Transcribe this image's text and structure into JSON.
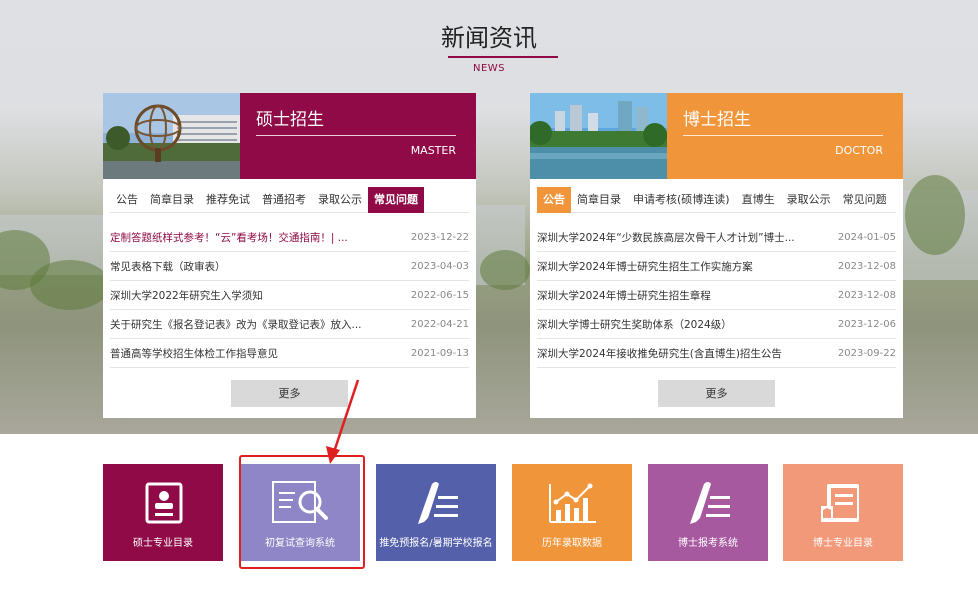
{
  "section": {
    "title": "新闻资讯",
    "subtitle": "NEWS"
  },
  "master": {
    "title": "硕士招生",
    "subtitle": "MASTER",
    "tabs": [
      {
        "label": "公告",
        "active": false
      },
      {
        "label": "简章目录",
        "active": false
      },
      {
        "label": "推荐免试",
        "active": false
      },
      {
        "label": "普通招考",
        "active": false
      },
      {
        "label": "录取公示",
        "active": false
      },
      {
        "label": "常见问题",
        "active": true
      }
    ],
    "news": [
      {
        "title": "定制答题纸样式参考！“云”看考场！交通指南！| ...",
        "date": "2023-12-22",
        "highlight": true
      },
      {
        "title": "常见表格下载（政审表）",
        "date": "2023-04-03",
        "highlight": false
      },
      {
        "title": "深圳大学2022年研究生入学须知",
        "date": "2022-06-15",
        "highlight": false
      },
      {
        "title": "关于研究生《报名登记表》改为《录取登记表》放入...",
        "date": "2022-04-21",
        "highlight": false
      },
      {
        "title": "普通高等学校招生体检工作指导意见",
        "date": "2021-09-13",
        "highlight": false
      }
    ],
    "more": "更多"
  },
  "doctor": {
    "title": "博士招生",
    "subtitle": "DOCTOR",
    "tabs": [
      {
        "label": "公告",
        "active": true
      },
      {
        "label": "简章目录",
        "active": false
      },
      {
        "label": "申请考核(硕博连读)",
        "active": false
      },
      {
        "label": "直博生",
        "active": false
      },
      {
        "label": "录取公示",
        "active": false
      },
      {
        "label": "常见问题",
        "active": false
      }
    ],
    "news": [
      {
        "title": "深圳大学2024年“少数民族高层次骨干人才计划”博士...",
        "date": "2024-01-05",
        "highlight": false
      },
      {
        "title": "深圳大学2024年博士研究生招生工作实施方案",
        "date": "2023-12-08",
        "highlight": false
      },
      {
        "title": "深圳大学2024年博士研究生招生章程",
        "date": "2023-12-08",
        "highlight": false
      },
      {
        "title": "深圳大学博士研究生奖助体系（2024级）",
        "date": "2023-12-06",
        "highlight": false
      },
      {
        "title": "深圳大学2024年接收推免研究生(含直博生)招生公告",
        "date": "2023-09-22",
        "highlight": false
      }
    ],
    "more": "更多"
  },
  "tiles": [
    {
      "label": "硕士专业目录",
      "color": "#8f0a46",
      "icon": "document-icon"
    },
    {
      "label": "初复试查询系统",
      "color": "#8e86c6",
      "icon": "search-document-icon"
    },
    {
      "label": "推免预报名/暑期学校报名",
      "color": "#5560ab",
      "icon": "pen-list-icon"
    },
    {
      "label": "历年录取数据",
      "color": "#f0953a",
      "icon": "bar-chart-icon"
    },
    {
      "label": "博士报考系统",
      "color": "#a759a0",
      "icon": "pen-list-icon"
    },
    {
      "label": "博士专业目录",
      "color": "#f2997a",
      "icon": "book-icon"
    }
  ],
  "colors": {
    "master": "#8f0a46",
    "doctor": "#f0953a",
    "annotation": "#e02020"
  }
}
